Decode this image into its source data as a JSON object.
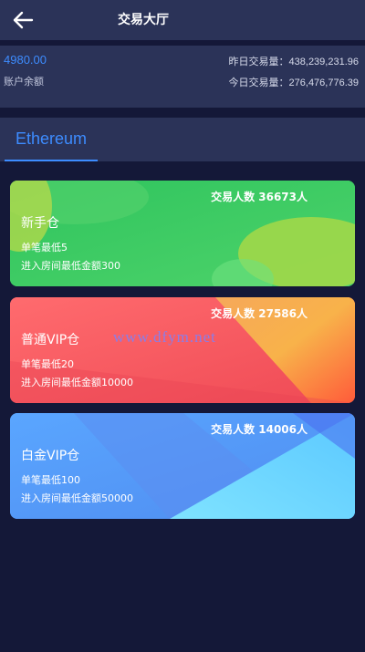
{
  "header": {
    "title": "交易大厅"
  },
  "balance": {
    "value": "4980.00",
    "label": "账户余额",
    "yesterday": "昨日交易量：438,239,231.96",
    "today": "今日交易量：276,476,776.39"
  },
  "tabs": [
    {
      "label": "Ethereum"
    }
  ],
  "rooms": [
    {
      "count": "交易人数 36673人",
      "name": "新手仓",
      "min_bet": "单笔最低5",
      "min_entry": "进入房间最低金额300"
    },
    {
      "count": "交易人数 27586人",
      "name": "普通VIP仓",
      "min_bet": "单笔最低20",
      "min_entry": "进入房间最低金额10000"
    },
    {
      "count": "交易人数 14006人",
      "name": "白金VIP仓",
      "min_bet": "单笔最低100",
      "min_entry": "进入房间最低金额50000"
    }
  ],
  "watermark": "www.dfym.net",
  "colors": {
    "background": "#141838",
    "panel": "#2b3358",
    "accent": "#3d8cff",
    "card_green": "#37c25a",
    "card_red": "#f25a5e",
    "card_blue": "#4f97f7"
  },
  "icons": {
    "back": "arrow-left-icon"
  }
}
